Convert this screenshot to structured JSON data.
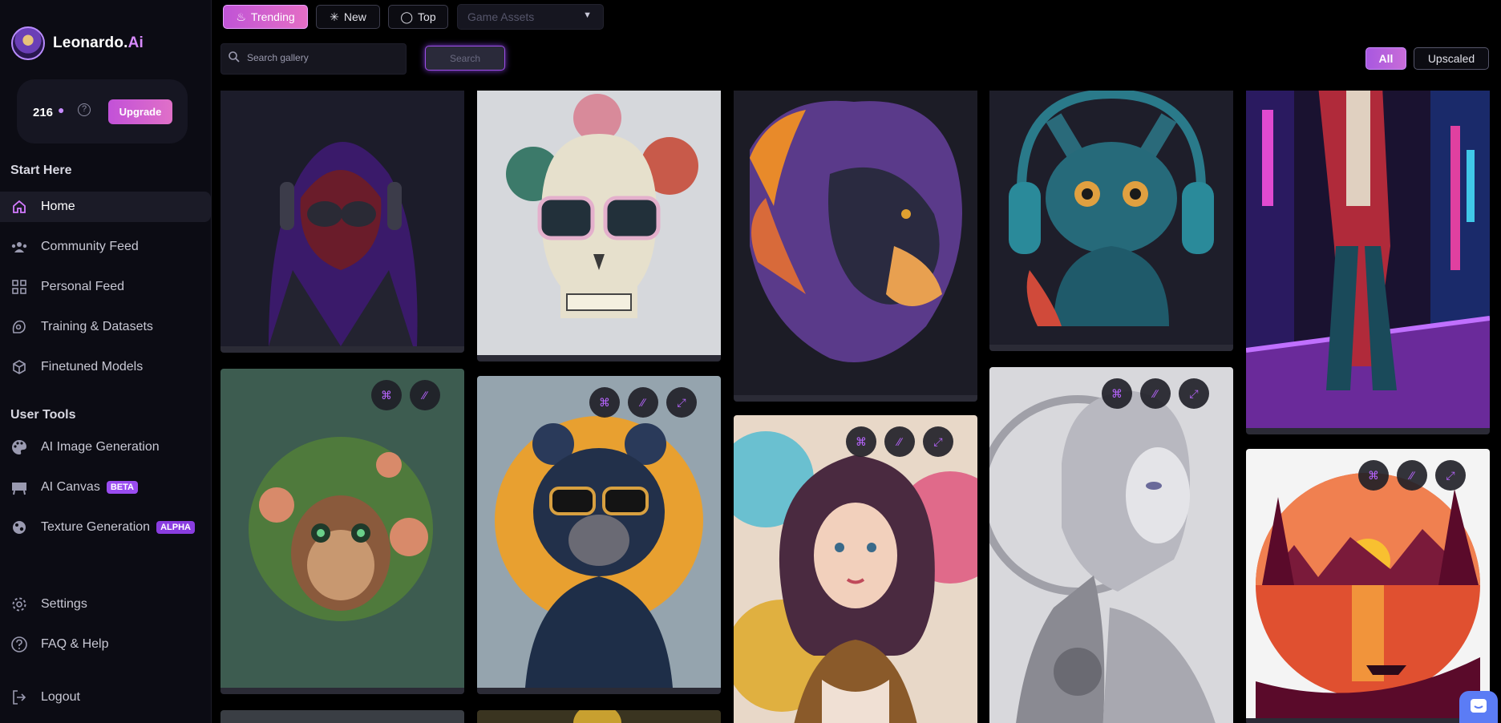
{
  "app": {
    "name_main": "Leonardo.",
    "name_accent": "Ai"
  },
  "credits": {
    "value": "216",
    "upgrade_label": "Upgrade"
  },
  "sidebar": {
    "start_here_title": "Start Here",
    "start_items": [
      {
        "label": "Home",
        "icon": "home-icon"
      },
      {
        "label": "Community Feed",
        "icon": "community-icon"
      },
      {
        "label": "Personal Feed",
        "icon": "grid-icon"
      },
      {
        "label": "Training & Datasets",
        "icon": "training-icon"
      },
      {
        "label": "Finetuned Models",
        "icon": "cube-icon"
      }
    ],
    "user_tools_title": "User Tools",
    "tool_items": [
      {
        "label": "AI Image Generation",
        "icon": "palette-icon"
      },
      {
        "label": "AI Canvas",
        "icon": "canvas-icon",
        "badge": "BETA"
      },
      {
        "label": "Texture Generation",
        "icon": "texture-icon",
        "badge": "ALPHA"
      }
    ],
    "bottom_items": [
      {
        "label": "Settings",
        "icon": "gear-icon"
      },
      {
        "label": "FAQ & Help",
        "icon": "help-icon"
      },
      {
        "label": "Logout",
        "icon": "logout-icon"
      }
    ]
  },
  "toolbar": {
    "tabs": [
      "Trending",
      "New",
      "Top"
    ],
    "category_placeholder": "Game Assets",
    "search_placeholder": "Search gallery",
    "search_label": "Search",
    "filters": [
      "All",
      "Upscaled"
    ]
  },
  "colors": {
    "accent": "#c054d6",
    "accent_2": "#e46ec5",
    "sidebar_bg": "#0c0c14",
    "page_bg": "#000000"
  },
  "gallery": {
    "images": [
      {
        "subject": "hooded-spider-hero"
      },
      {
        "subject": "floral-skull-sunglasses"
      },
      {
        "subject": "neon-lion"
      },
      {
        "subject": "headphone-cat"
      },
      {
        "subject": "neon-city-walker"
      },
      {
        "subject": "floral-monkey"
      },
      {
        "subject": "bear-sunglasses"
      },
      {
        "subject": "victorian-girl"
      },
      {
        "subject": "cyborg-woman"
      },
      {
        "subject": "sunset-lake"
      }
    ]
  }
}
